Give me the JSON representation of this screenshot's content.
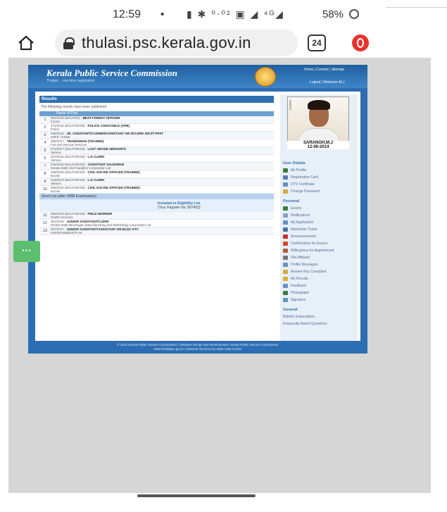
{
  "status_bar": {
    "time": "12:59",
    "indicator": "•",
    "icons_text": "▮ ✱ ⁰⋅⁰² ▣ ◢ ⁴ᴳ◢",
    "battery": "58%"
  },
  "browser": {
    "url": "thulasi.psc.kerala.gov.in",
    "tab_count": "24",
    "icons": [
      "home-icon",
      "lock-icon",
      "tabs-icon",
      "opera-icon"
    ]
  },
  "site": {
    "title": "Kerala Public Service Commission",
    "subtitle": "Thulasi ... one time registration",
    "topnav": "Home | Contact | Sitemap",
    "logout": "Logout | Welcome M.J",
    "results_heading": "Results",
    "results_note": "The following results have been published",
    "col_header": "Name of Post",
    "rows": [
      {
        "num": "1",
        "cat": "001/2015 (MALPUR)",
        "title": "BEAT FOREST OFFICER",
        "dept": "Forest"
      },
      {
        "num": "2",
        "cat": "471/2015 (MALPURAM)",
        "title": "POLICE CONSTABLE (APB)",
        "dept": "Police"
      },
      {
        "num": "3",
        "cat": "035/2016",
        "title": "JR. ASSISTANT/CASHIER/ASSISTANT GR II/CLERK GR.I/TYPIST",
        "dept": "KSFE / KSEB"
      },
      {
        "num": "4",
        "cat": "005/2017",
        "title": "TRADESMAN (TRAINEE)",
        "dept": "Fire and Rescue Services"
      },
      {
        "num": "5",
        "cat": "071/2017 (MALPURAM)",
        "title": "LAST GRADE SERVANTS",
        "dept": "Various"
      },
      {
        "num": "6",
        "cat": "207/2016 (MALPURAM)",
        "title": "L.D CLERK",
        "dept": "Various"
      },
      {
        "num": "7",
        "cat": "015/2015 (MALPURAM)",
        "title": "ASSISTANT SALESMAN",
        "dept": "Kerala State Civil Supplies Corporation Ltd"
      },
      {
        "num": "8",
        "cat": "406/2015 (MALPURAM)",
        "title": "CIVIL EXCISE OFFICER (TRAINEE)",
        "dept": "Excise"
      },
      {
        "num": "9",
        "cat": "416/2013 (MALPURAM)",
        "title": "L.D CLERK",
        "dept": "Various"
      },
      {
        "num": "10",
        "cat": "406/2015 (MALPURAM)",
        "title": "CIVIL EXCISE OFFICER (TRAINEE)",
        "dept": "Excise"
      }
    ],
    "shortlist_heading": "Short List (after OMR Examination)",
    "shortlist_line1": "Included in Eligibility List",
    "shortlist_line2": "(Your Register No: 897403)",
    "rows2": [
      {
        "num": "11",
        "cat": "395/2016 (MALPURAM)",
        "title": "FIELD WORKER",
        "dept": "Health Services"
      },
      {
        "num": "12",
        "cat": "001/2016",
        "title": "JUNIOR ASSISTANT/CLERK",
        "dept": "Kerala State Beverages (Manufacturing and Marketing) Corporation Ltd"
      },
      {
        "num": "13",
        "cat": "297/2017",
        "title": "JUNIOR ASSISTANT/ASSISTANT GR.II/LDC ETC",
        "dept": "KSFE/KSEB/KSTP etc"
      }
    ],
    "photo_caption_name": "SARANGH.M.J",
    "photo_caption_date": "12-06-2014",
    "photo_side": "PHOTO",
    "user_details_heading": "User Details",
    "user_details": [
      "My Profile",
      "Registration Card",
      "OTV Certificate",
      "Change Password"
    ],
    "personal_heading": "Personal",
    "personal": [
      "Exams",
      "Notifications",
      "My Application",
      "Admission Ticket",
      "Announcements",
      "Confirmation for Exams",
      "Willingness for Appointment",
      "File Affidavit",
      "Profile Messages",
      "Answer Key Complaint",
      "My Results",
      "Feedback",
      "Photograph",
      "Signature"
    ],
    "general_heading": "General",
    "general": [
      "Bulletin Subscription",
      "Frequently Asked Questions"
    ],
    "footer_line1": "© 2012 Kerala Public Service Commission | Software Design and Development: Kerala Public Service Commission",
    "footer_line2": "www.keralapsc.gov.in | Network Services by State Data Center"
  },
  "colors": {
    "site_blue": "#2d6db3",
    "sidebar_bg": "#e7eff8",
    "float_button": "#5cbf6d",
    "opera_red": "#e8322c"
  }
}
